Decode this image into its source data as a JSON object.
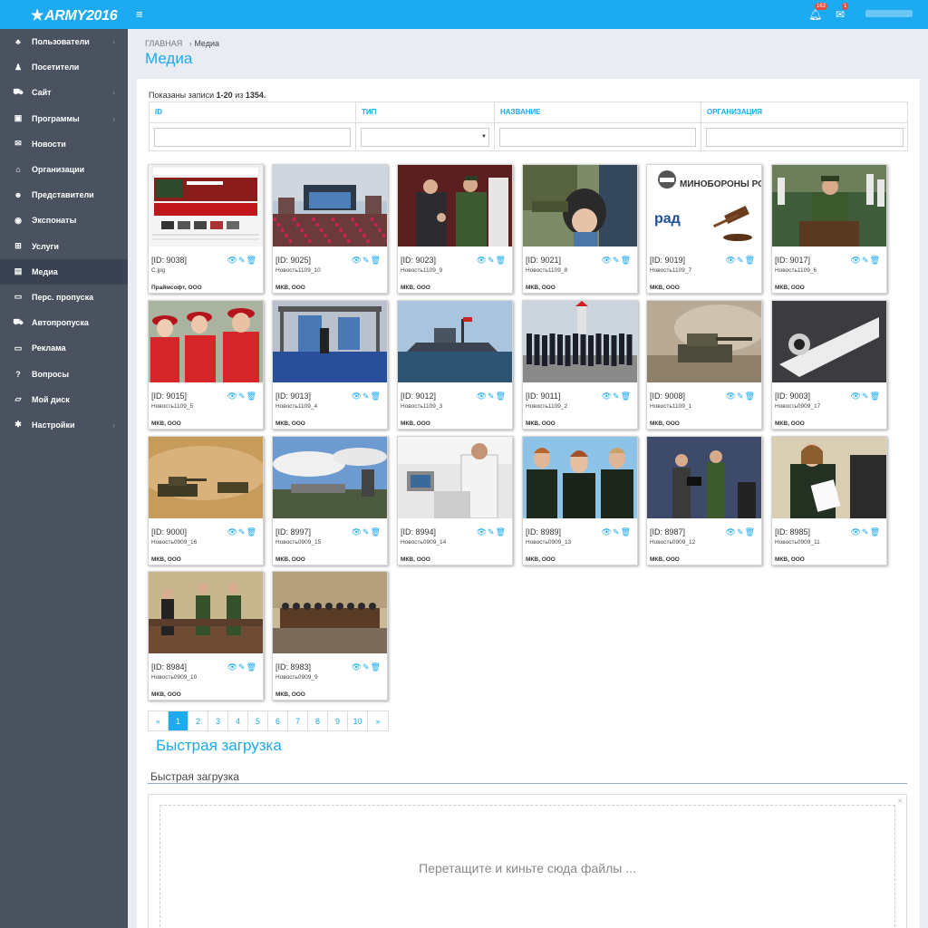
{
  "app": {
    "logo_text": "ARMY2016",
    "notifications_count": "163",
    "messages_count": "1"
  },
  "sidebar": {
    "items": [
      {
        "label": "Пользователи",
        "icon": "sitemap-icon",
        "glyph": "♣",
        "arrow": true
      },
      {
        "label": "Посетители",
        "icon": "user-icon",
        "glyph": "♟",
        "arrow": false
      },
      {
        "label": "Сайт",
        "icon": "car-icon",
        "glyph": "⛟",
        "arrow": true
      },
      {
        "label": "Программы",
        "icon": "briefcase-icon",
        "glyph": "▣",
        "arrow": true
      },
      {
        "label": "Новости",
        "icon": "comments-icon",
        "glyph": "✉",
        "arrow": false
      },
      {
        "label": "Организации",
        "icon": "bank-icon",
        "glyph": "⌂",
        "arrow": false
      },
      {
        "label": "Представители",
        "icon": "users-icon",
        "glyph": "☻",
        "arrow": false
      },
      {
        "label": "Экспонаты",
        "icon": "eye-slash-icon",
        "glyph": "◉",
        "arrow": false
      },
      {
        "label": "Услуги",
        "icon": "cart-icon",
        "glyph": "⊞",
        "arrow": false
      },
      {
        "label": "Медиа",
        "icon": "file-icon",
        "glyph": "▤",
        "arrow": false,
        "active": true
      },
      {
        "label": "Перс. пропуска",
        "icon": "card-icon",
        "glyph": "▭",
        "arrow": false
      },
      {
        "label": "Автопропуска",
        "icon": "car2-icon",
        "glyph": "⛟",
        "arrow": false
      },
      {
        "label": "Реклама",
        "icon": "credit-card-icon",
        "glyph": "▭",
        "arrow": false
      },
      {
        "label": "Вопросы",
        "icon": "question-icon",
        "glyph": "?",
        "arrow": false
      },
      {
        "label": "Мой диск",
        "icon": "hdd-icon",
        "glyph": "▱",
        "arrow": false
      },
      {
        "label": "Настройки",
        "icon": "cogs-icon",
        "glyph": "✱",
        "arrow": true
      }
    ]
  },
  "breadcrumb": {
    "home": "ГЛАВНАЯ",
    "current": "Медиа"
  },
  "page_title": "Медиа",
  "summary": {
    "prefix": "Показаны записи",
    "range": "1-20",
    "mid": "из",
    "total": "1354",
    "suffix": "."
  },
  "filters": {
    "columns": [
      "ID",
      "ТИП",
      "НАЗВАНИЕ",
      "ОРГАНИЗАЦИЯ"
    ],
    "values": [
      "",
      "",
      "",
      ""
    ]
  },
  "media": [
    {
      "id": "[ID: 9038]",
      "name": "C.jpg",
      "org": "Праймсофт, ООО"
    },
    {
      "id": "[ID: 9025]",
      "name": "Новость1109_10",
      "org": "МКВ, ООО"
    },
    {
      "id": "[ID: 9023]",
      "name": "Новость1109_9",
      "org": "МКВ, ООО"
    },
    {
      "id": "[ID: 9021]",
      "name": "Новость1109_8",
      "org": "МКВ, ООО"
    },
    {
      "id": "[ID: 9019]",
      "name": "Новость1109_7",
      "org": "МКВ, ООО"
    },
    {
      "id": "[ID: 9017]",
      "name": "Новость1109_6",
      "org": "МКВ, ООО"
    },
    {
      "id": "[ID: 9015]",
      "name": "Новость1109_5",
      "org": "МКВ, ООО"
    },
    {
      "id": "[ID: 9013]",
      "name": "Новость1109_4",
      "org": "МКВ, ООО"
    },
    {
      "id": "[ID: 9012]",
      "name": "Новость1109_3",
      "org": "МКВ, ООО"
    },
    {
      "id": "[ID: 9011]",
      "name": "Новость1109_2",
      "org": "МКВ, ООО"
    },
    {
      "id": "[ID: 9008]",
      "name": "Новость1109_1",
      "org": "МКВ, ООО"
    },
    {
      "id": "[ID: 9003]",
      "name": "Новость0909_17",
      "org": "МКВ, ООО"
    },
    {
      "id": "[ID: 9000]",
      "name": "Новость0909_16",
      "org": "МКВ, ООО"
    },
    {
      "id": "[ID: 8997]",
      "name": "Новость0909_15",
      "org": "МКВ, ООО"
    },
    {
      "id": "[ID: 8994]",
      "name": "Новость0909_14",
      "org": "МКВ, ООО"
    },
    {
      "id": "[ID: 8989]",
      "name": "Новость0909_13",
      "org": "МКВ, ООО"
    },
    {
      "id": "[ID: 8987]",
      "name": "Новость0909_12",
      "org": "МКВ, ООО"
    },
    {
      "id": "[ID: 8985]",
      "name": "Новость0909_11",
      "org": "МКВ, ООО"
    },
    {
      "id": "[ID: 8984]",
      "name": "Новость0909_10",
      "org": "МКВ, ООО"
    },
    {
      "id": "[ID: 8983]",
      "name": "Новость0909_9",
      "org": "МКВ, ООО"
    }
  ],
  "thumb_texts": {
    "ministry": "МИНОБОРОНЫ РОССИИ",
    "rad": "рад"
  },
  "card_actions": {
    "view": "👁",
    "edit": "✎",
    "delete": "🗑"
  },
  "pagination": {
    "prev": "«",
    "pages": [
      "1",
      "2",
      "3",
      "4",
      "5",
      "6",
      "7",
      "8",
      "9",
      "10"
    ],
    "next": "»",
    "active": "1"
  },
  "quick_upload": {
    "title": "Быстрая загрузка",
    "section_label": "Быстрая загрузка",
    "dropzone_text": "Перетащите и киньте сюда файлы ...",
    "close": "×"
  },
  "colors": {
    "accent": "#1caaf0",
    "sidebar": "#4a5260",
    "sidebar_active": "#3a4150",
    "background": "#e9ecf2"
  }
}
